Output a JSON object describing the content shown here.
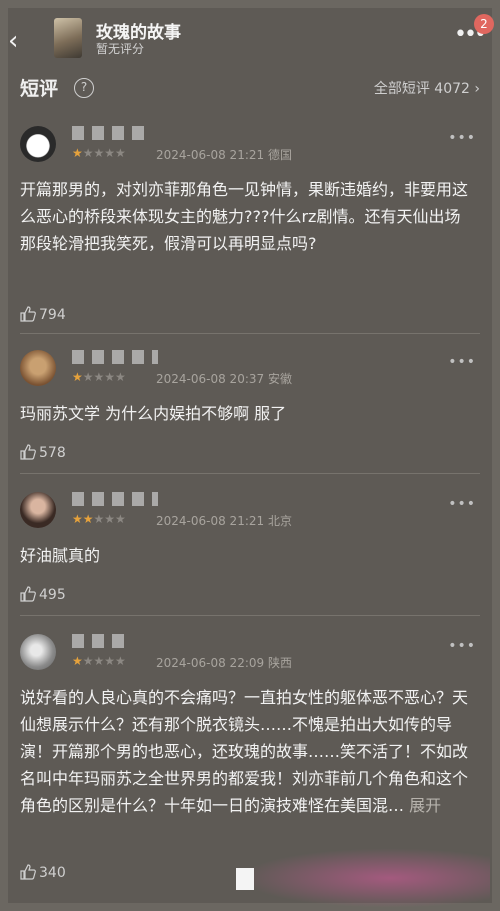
{
  "header": {
    "back_icon": "chevron-left-icon",
    "title": "玫瑰的故事",
    "subtitle": "暂无评分",
    "more_icon": "more-horizontal-icon",
    "badge_count": "2"
  },
  "section": {
    "title": "短评",
    "help_icon": "?",
    "all_link": "全部短评 4072 ›"
  },
  "comments": [
    {
      "stars_on": "★",
      "stars_off": "★★★★",
      "meta": "2024-06-08 21:21 德国",
      "content": "开篇那男的，对刘亦菲那角色一见钟情，果断违婚约，非要用这么恶心的桥段来体现女主的魅力???什么rz剧情。还有天仙出场那段轮滑把我笑死，假滑可以再明显点吗?",
      "likes": "794"
    },
    {
      "stars_on": "★",
      "stars_off": "★★★★",
      "meta": "2024-06-08 20:37 安徽",
      "content": "玛丽苏文学 为什么内娱拍不够啊 服了",
      "likes": "578"
    },
    {
      "stars_on": "★★",
      "stars_off": "★★★",
      "meta": "2024-06-08 21:21 北京",
      "content": "好油腻真的",
      "likes": "495"
    },
    {
      "stars_on": "★",
      "stars_off": "★★★★",
      "meta": "2024-06-08 22:09 陕西",
      "content": "说好看的人良心真的不会痛吗？一直拍女性的躯体恶不恶心？天仙想展示什么？还有那个脱衣镜头……不愧是拍出大如传的导演！开篇那个男的也恶心，还玫瑰的故事……笑不活了！不如改名叫中年玛丽苏之全世界男的都爱我！刘亦菲前几个角色和这个角色的区别是什么？十年如一日的演技难怪在美国混…",
      "expand": "展开",
      "likes": "340"
    }
  ]
}
